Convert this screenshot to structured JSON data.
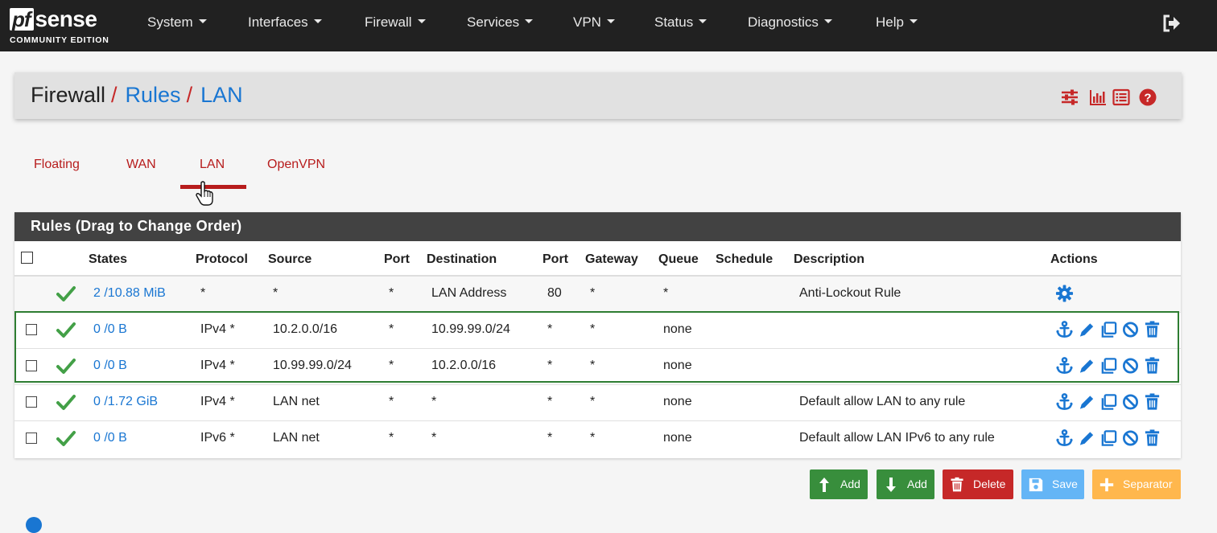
{
  "navbar": {
    "logo_pf": "pf",
    "logo_sense": "sense",
    "logo_sub": "COMMUNITY EDITION",
    "menus": [
      "System",
      "Interfaces",
      "Firewall",
      "Services",
      "VPN",
      "Status",
      "Diagnostics",
      "Help"
    ]
  },
  "breadcrumb": {
    "root": "Firewall",
    "separator": "/",
    "rules": "Rules",
    "current": "LAN"
  },
  "tabs": [
    "Floating",
    "WAN",
    "LAN",
    "OpenVPN"
  ],
  "active_tab": "LAN",
  "panel": {
    "title": "Rules (Drag to Change Order)"
  },
  "table": {
    "headers": {
      "states": "States",
      "protocol": "Protocol",
      "source": "Source",
      "port": "Port",
      "destination": "Destination",
      "dport": "Port",
      "gateway": "Gateway",
      "queue": "Queue",
      "schedule": "Schedule",
      "description": "Description",
      "actions": "Actions"
    },
    "rows": [
      {
        "states": "2 /10.88 MiB",
        "protocol": "*",
        "source": "*",
        "port": "*",
        "destination": "LAN Address",
        "dport": "80",
        "gateway": "*",
        "queue": "*",
        "schedule": "",
        "description": "Anti-Lockout Rule"
      },
      {
        "states": "0 /0 B",
        "protocol": "IPv4 *",
        "source": "10.2.0.0/16",
        "port": "*",
        "destination": "10.99.99.0/24",
        "dport": "*",
        "gateway": "*",
        "queue": "none",
        "schedule": "",
        "description": ""
      },
      {
        "states": "0 /0 B",
        "protocol": "IPv4 *",
        "source": "10.99.99.0/24",
        "port": "*",
        "destination": "10.2.0.0/16",
        "dport": "*",
        "gateway": "*",
        "queue": "none",
        "schedule": "",
        "description": ""
      },
      {
        "states": "0 /1.72 GiB",
        "protocol": "IPv4 *",
        "source": "LAN net",
        "port": "*",
        "destination": "*",
        "dport": "*",
        "gateway": "*",
        "queue": "none",
        "schedule": "",
        "description": "Default allow LAN to any rule"
      },
      {
        "states": "0 /0 B",
        "protocol": "IPv6 *",
        "source": "LAN net",
        "port": "*",
        "destination": "*",
        "dport": "*",
        "gateway": "*",
        "queue": "none",
        "schedule": "",
        "description": "Default allow LAN IPv6 to any rule"
      }
    ]
  },
  "buttons": {
    "add_top": "Add",
    "add_bottom": "Add",
    "delete": "Delete",
    "save": "Save",
    "separator": "Separator"
  },
  "colors": {
    "navbar": "#212121",
    "accent_red": "#b71c1c",
    "link_blue": "#1976d2",
    "success_green": "#388e3c",
    "danger_red": "#c62828",
    "save_blue": "#64b5f6",
    "warning_orange": "#ffb74d"
  },
  "icons": {
    "logout": "sign-out-icon",
    "header": [
      "sliders-icon",
      "bar-chart-icon",
      "list-icon",
      "help-icon"
    ],
    "row_actions": [
      "anchor-icon",
      "pencil-icon",
      "copy-icon",
      "ban-icon",
      "trash-icon"
    ],
    "anti_lockout_action": "gear-icon",
    "status": "check-icon"
  }
}
